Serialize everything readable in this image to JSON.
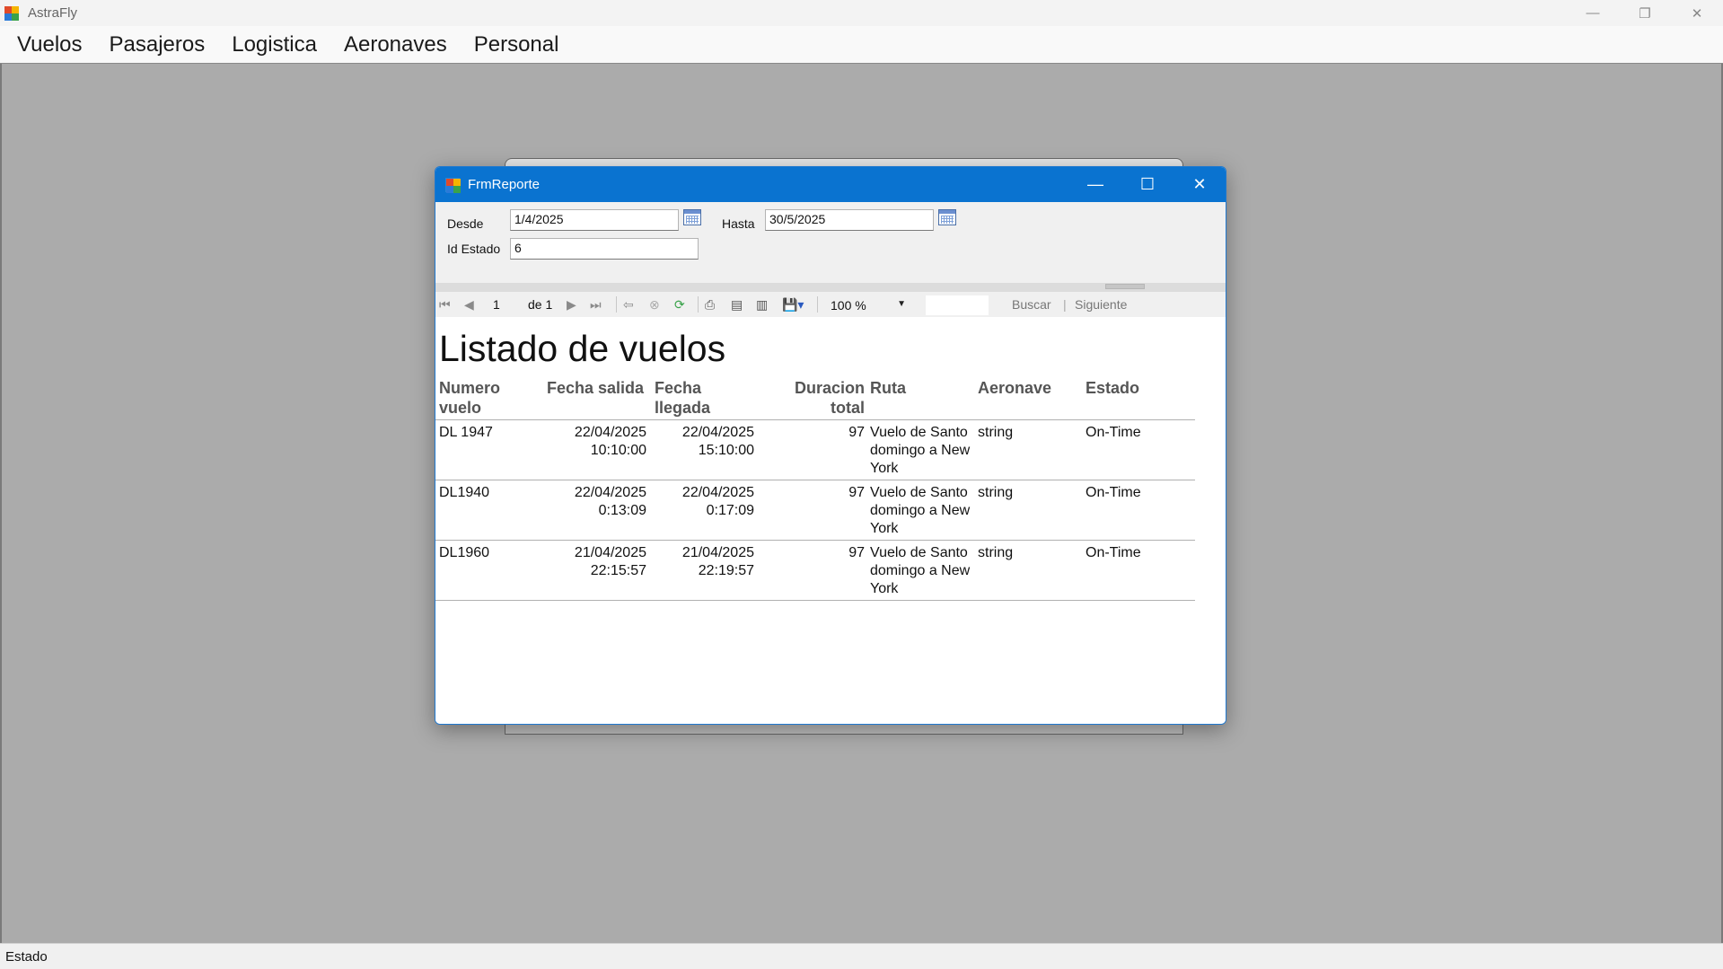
{
  "app": {
    "title": "AstraFly",
    "controls": {
      "minimize": "—",
      "maximize": "❐",
      "close": "✕"
    }
  },
  "menu": [
    "Vuelos",
    "Pasajeros",
    "Logistica",
    "Aeronaves",
    "Personal"
  ],
  "status_bar": {
    "text": "Estado"
  },
  "form": {
    "title": "FrmReporte",
    "controls": {
      "minimize": "—",
      "maximize": "☐",
      "close": "✕"
    },
    "filters": {
      "desde_label": "Desde",
      "desde_value": "1/4/2025",
      "hasta_label": "Hasta",
      "hasta_value": "30/5/2025",
      "id_estado_label": "Id Estado",
      "id_estado_value": "6"
    },
    "toolbar": {
      "page_current": "1",
      "page_of_label": "de 1",
      "zoom": "100 %",
      "find_label": "Buscar",
      "next_label": "Siguiente",
      "separator": "|"
    }
  },
  "report": {
    "title": "Listado de vuelos",
    "columns": {
      "numero": [
        "Numero",
        "vuelo"
      ],
      "salida": [
        "Fecha salida"
      ],
      "llegada": [
        "Fecha",
        "llegada"
      ],
      "duracion": [
        "Duracion",
        "total"
      ],
      "ruta": [
        "Ruta"
      ],
      "aeronave": [
        "Aeronave"
      ],
      "estado": [
        "Estado"
      ]
    },
    "rows": [
      {
        "numero": "DL 1947",
        "salida_fecha": "22/04/2025",
        "salida_hora": "10:10:00",
        "llegada_fecha": "22/04/2025",
        "llegada_hora": "15:10:00",
        "duracion": "97",
        "ruta": [
          "Vuelo de Santo",
          "domingo a New",
          "York"
        ],
        "aeronave": "string",
        "estado": "On-Time"
      },
      {
        "numero": "DL1940",
        "salida_fecha": "22/04/2025",
        "salida_hora": "0:13:09",
        "llegada_fecha": "22/04/2025",
        "llegada_hora": "0:17:09",
        "duracion": "97",
        "ruta": [
          "Vuelo de Santo",
          "domingo a New",
          "York"
        ],
        "aeronave": "string",
        "estado": "On-Time"
      },
      {
        "numero": "DL1960",
        "salida_fecha": "21/04/2025",
        "salida_hora": "22:15:57",
        "llegada_fecha": "21/04/2025",
        "llegada_hora": "22:19:57",
        "duracion": "97",
        "ruta": [
          "Vuelo de Santo",
          "domingo a New",
          "York"
        ],
        "aeronave": "string",
        "estado": "On-Time"
      }
    ]
  }
}
